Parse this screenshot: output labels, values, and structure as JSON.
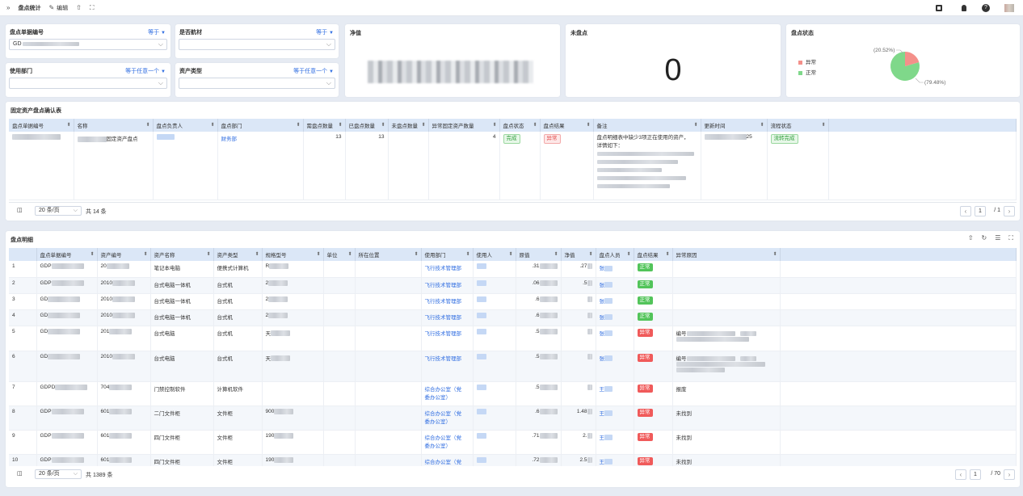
{
  "topbar": {
    "expand_glyph": "»",
    "title": "盘点统计",
    "edit_label": "编辑",
    "share_glyph": "⇧",
    "fullscreen_glyph": "⛶"
  },
  "filters": [
    {
      "label": "盘点单据编号",
      "op": "等于",
      "value": "GD"
    },
    {
      "label": "是否航材",
      "op": "等于",
      "value": ""
    },
    {
      "label": "使用部门",
      "op": "等于任意一个",
      "value": ""
    },
    {
      "label": "资产类型",
      "op": "等于任意一个",
      "value": ""
    }
  ],
  "kpi": {
    "net_title": "净值",
    "uncounted_title": "未盘点",
    "uncounted_value": "0"
  },
  "status_chart": {
    "title": "盘点状态",
    "legend": [
      {
        "name": "异常",
        "color": "#f4908a"
      },
      {
        "name": "正常",
        "color": "#7fd88a"
      }
    ],
    "label_abnormal": "(20.52%)",
    "label_normal": "(79.48%)"
  },
  "chart_data": {
    "type": "pie",
    "title": "盘点状态",
    "slices": [
      {
        "name": "异常",
        "value": 20.52,
        "color": "#f4908a"
      },
      {
        "name": "正常",
        "value": 79.48,
        "color": "#7fd88a"
      }
    ]
  },
  "confirm_table": {
    "title": "固定资产盘点确认表",
    "headers": [
      "盘点单据编号",
      "名称",
      "盘点负责人",
      "盘点部门",
      "需盘点数量",
      "已盘点数量",
      "未盘点数量",
      "异常固定资产数量",
      "盘点状态",
      "盘点结果",
      "备注",
      "更新时间",
      "流程状态"
    ],
    "row": {
      "name_suffix": "固定资产盘点",
      "dept": "财务部",
      "need": "13",
      "done": "13",
      "abnormal": "4",
      "status": "完成",
      "result": "异常",
      "note_line1": "盘点明细表中缺少3项正在使用的资产，",
      "note_line2": "详情如下：",
      "update_suffix": "25",
      "flow": "流转完成"
    },
    "pager": {
      "size": "20 条/页",
      "total": "共 14 条",
      "page": "1",
      "pages": "/ 1"
    }
  },
  "detail_table": {
    "title": "盘点明细",
    "headers": [
      "盘点单据编号",
      "资产编号",
      "资产名称",
      "资产类型",
      "规格型号",
      "单位",
      "所在位置",
      "使用部门",
      "使用人",
      "原值",
      "净值",
      "盘点人员",
      "盘点结果",
      "异常原因"
    ],
    "rows": [
      {
        "idx": "1",
        "code": "GDP",
        "asset": "20",
        "name": "笔记本电脑",
        "type": "便携式计算机",
        "model": "R",
        "dept": "飞行技术管理部",
        "dept2": "",
        "orig": ".31",
        "net": ".27",
        "person": "张",
        "result": "正常",
        "reason": ""
      },
      {
        "idx": "2",
        "code": "GDP",
        "asset": "2010",
        "name": "台式电脑一体机",
        "type": "台式机",
        "model": "2",
        "dept": "飞行技术管理部",
        "dept2": "",
        "orig": ".06",
        "net": ".5",
        "person": "张",
        "result": "正常",
        "reason": ""
      },
      {
        "idx": "3",
        "code": "GD",
        "asset": "2010",
        "name": "台式电脑一体机",
        "type": "台式机",
        "model": "2",
        "dept": "飞行技术管理部",
        "dept2": "",
        "orig": ".6",
        "net": "",
        "person": "张",
        "result": "正常",
        "reason": ""
      },
      {
        "idx": "4",
        "code": "GD",
        "asset": "2010",
        "name": "台式电脑一体机",
        "type": "台式机",
        "model": "2",
        "dept": "飞行技术管理部",
        "dept2": "",
        "orig": ".6",
        "net": "",
        "person": "张",
        "result": "正常",
        "reason": ""
      },
      {
        "idx": "5",
        "code": "GD",
        "asset": "201",
        "name": "台式电脑",
        "type": "台式机",
        "model": "天",
        "dept": "飞行技术管理部",
        "dept2": "",
        "orig": ".5",
        "net": "",
        "person": "张",
        "result": "异常",
        "reason": "编号"
      },
      {
        "idx": "6",
        "code": "GD",
        "asset": "2010",
        "name": "台式电脑",
        "type": "台式机",
        "model": "天",
        "dept": "飞行技术管理部",
        "dept2": "",
        "orig": ".5",
        "net": "",
        "person": "张",
        "result": "异常",
        "reason": "编号"
      },
      {
        "idx": "7",
        "code": "GDPD",
        "asset": "704",
        "name": "门禁控制软件",
        "type": "计算机软件",
        "model": "",
        "dept": "综合办公室（党",
        "dept2": "委办公室）",
        "orig": ".5",
        "net": "",
        "person": "王",
        "result": "异常",
        "reason": "报废"
      },
      {
        "idx": "8",
        "code": "GDP",
        "asset": "601",
        "name": "二门文件柜",
        "type": "文件柜",
        "model": "900",
        "dept": "综合办公室（党",
        "dept2": "委办公室）",
        "orig": ".6",
        "net": "1.48",
        "person": "王",
        "result": "异常",
        "reason": "未找到"
      },
      {
        "idx": "9",
        "code": "GDP",
        "asset": "601",
        "name": "四门文件柜",
        "type": "文件柜",
        "model": "190",
        "dept": "综合办公室（党",
        "dept2": "委办公室）",
        "orig": ".71",
        "net": "2.",
        "person": "王",
        "result": "异常",
        "reason": "未找到"
      },
      {
        "idx": "10",
        "code": "GDP",
        "asset": "601",
        "name": "四门文件柜",
        "type": "文件柜",
        "model": "190",
        "dept": "综合办公室（党",
        "dept2": "委办公室）",
        "orig": ".72",
        "net": "2.5",
        "person": "王",
        "result": "异常",
        "reason": "未找到"
      }
    ],
    "pager": {
      "size": "20 条/页",
      "total": "共 1389 条",
      "page": "1",
      "pages": "/ 70"
    }
  },
  "colors": {
    "accent": "#2f6de1",
    "header_bg": "#dbe7f7",
    "ok": "#52c45a",
    "error": "#f05a5a"
  }
}
